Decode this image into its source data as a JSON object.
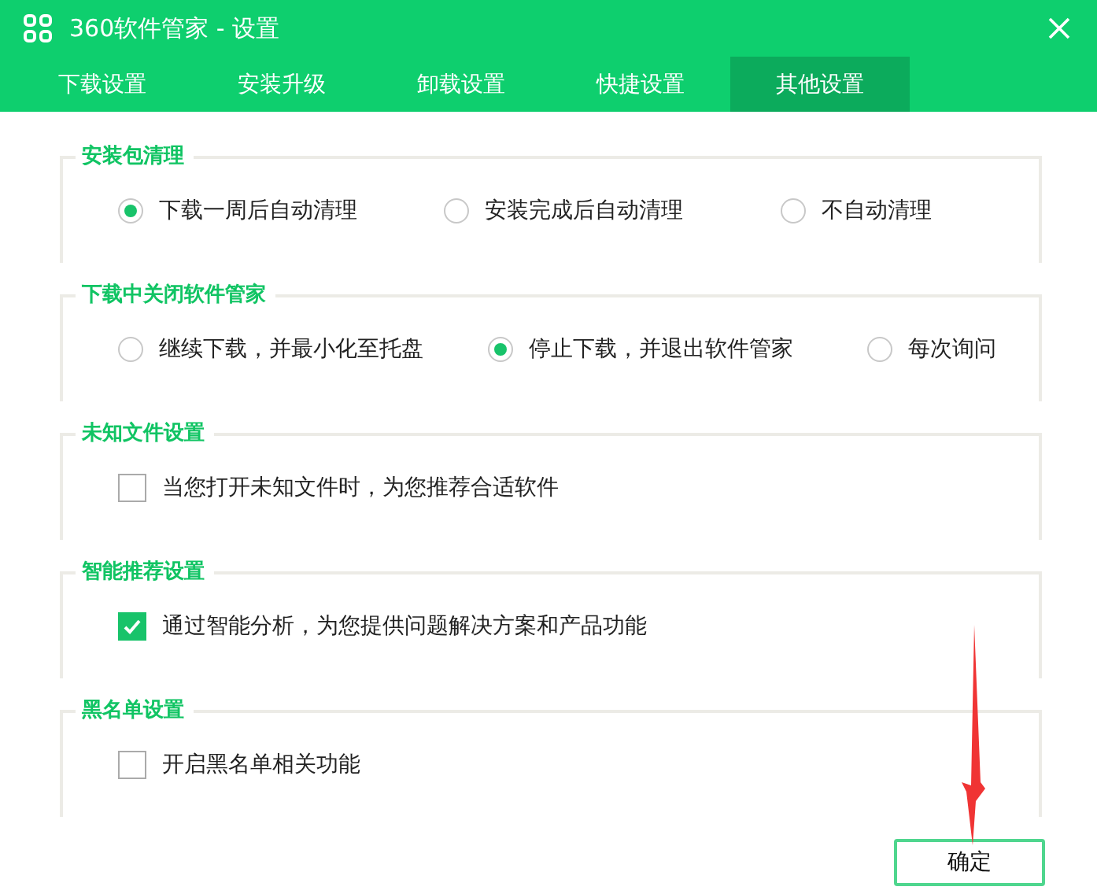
{
  "window": {
    "title": "360软件管家 - 设置"
  },
  "tabs": [
    {
      "label": "下载设置",
      "selected": false
    },
    {
      "label": "安装升级",
      "selected": false
    },
    {
      "label": "卸载设置",
      "selected": false
    },
    {
      "label": "快捷设置",
      "selected": false
    },
    {
      "label": "其他设置",
      "selected": true
    }
  ],
  "sections": [
    {
      "title": "安装包清理",
      "kind": "radio",
      "options": [
        {
          "label": "下载一周后自动清理",
          "selected": true
        },
        {
          "label": "安装完成后自动清理",
          "selected": false
        },
        {
          "label": "不自动清理",
          "selected": false
        }
      ]
    },
    {
      "title": "下载中关闭软件管家",
      "kind": "radio",
      "options": [
        {
          "label": "继续下载，并最小化至托盘",
          "selected": false
        },
        {
          "label": "停止下载，并退出软件管家",
          "selected": true
        },
        {
          "label": "每次询问",
          "selected": false
        }
      ]
    },
    {
      "title": "未知文件设置",
      "kind": "checkbox",
      "options": [
        {
          "label": "当您打开未知文件时，为您推荐合适软件",
          "checked": false
        }
      ]
    },
    {
      "title": "智能推荐设置",
      "kind": "checkbox",
      "options": [
        {
          "label": "通过智能分析，为您提供问题解决方案和产品功能",
          "checked": true
        }
      ]
    },
    {
      "title": "黑名单设置",
      "kind": "checkbox",
      "options": [
        {
          "label": "开启黑名单相关功能",
          "checked": false
        }
      ]
    }
  ],
  "buttons": [
    {
      "label": "确定"
    }
  ]
}
